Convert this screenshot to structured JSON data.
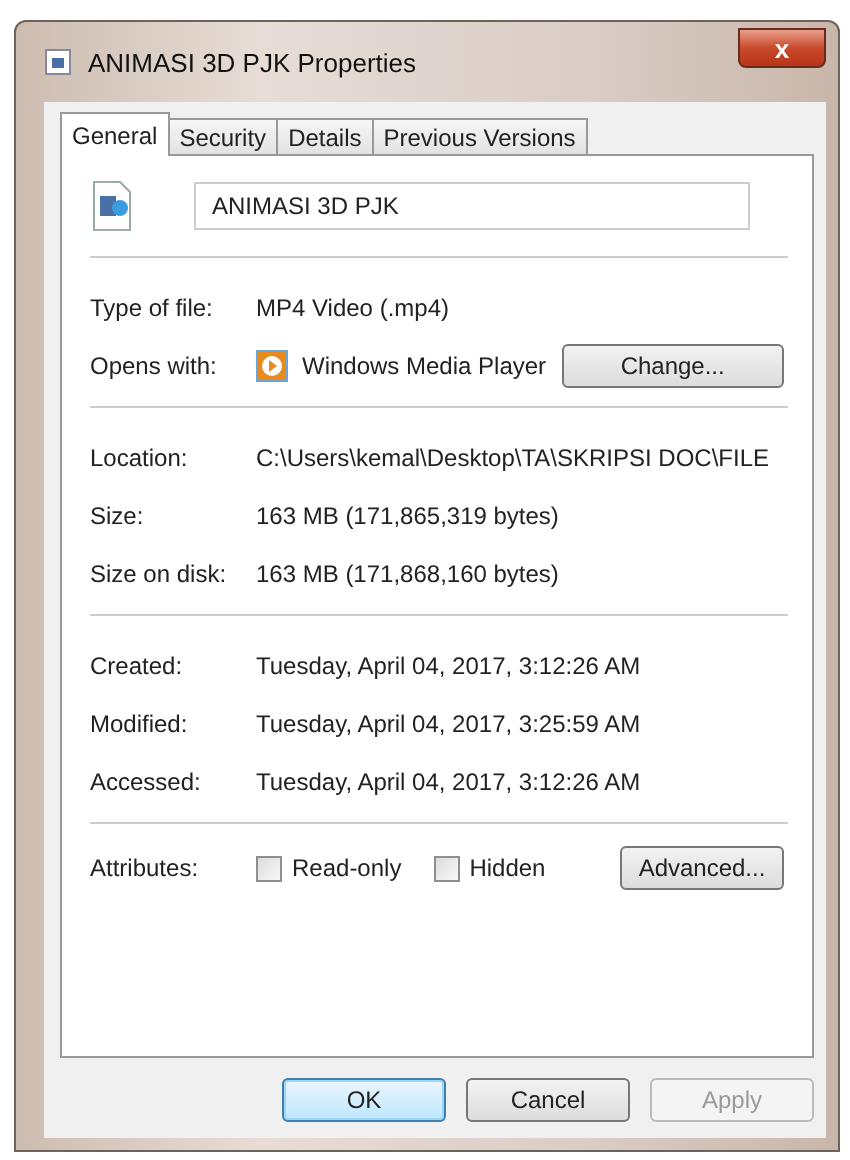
{
  "window": {
    "title": "ANIMASI 3D PJK  Properties",
    "close": "x"
  },
  "tabs": [
    {
      "label": "General",
      "selected": true
    },
    {
      "label": "Security",
      "selected": false
    },
    {
      "label": "Details",
      "selected": false
    },
    {
      "label": "Previous Versions",
      "selected": false
    }
  ],
  "file_name": {
    "value": "ANIMASI 3D PJK"
  },
  "sections": [
    [
      {
        "kind": "text",
        "label": "Type of file:",
        "value": "MP4 Video (.mp4)"
      },
      {
        "kind": "app",
        "label": "Opens with:",
        "value": "Windows Media Player",
        "button": "Change..."
      }
    ],
    [
      {
        "kind": "text",
        "label": "Location:",
        "value": "C:\\Users\\kemal\\Desktop\\TA\\SKRIPSI DOC\\FILE"
      },
      {
        "kind": "text",
        "label": "Size:",
        "value": "163 MB (171,865,319 bytes)"
      },
      {
        "kind": "text",
        "label": "Size on disk:",
        "value": "163 MB (171,868,160 bytes)"
      }
    ],
    [
      {
        "kind": "text",
        "label": "Created:",
        "value": "Tuesday, April 04, 2017, 3:12:26 AM"
      },
      {
        "kind": "text",
        "label": "Modified:",
        "value": "Tuesday, April 04, 2017, 3:25:59 AM"
      },
      {
        "kind": "text",
        "label": "Accessed:",
        "value": "Tuesday, April 04, 2017, 3:12:26 AM"
      }
    ]
  ],
  "attributes": {
    "label": "Attributes:",
    "options": [
      {
        "label": "Read-only",
        "checked": false
      },
      {
        "label": "Hidden",
        "checked": false
      }
    ],
    "button": "Advanced..."
  },
  "buttons": [
    {
      "label": "OK",
      "default": true,
      "disabled": false
    },
    {
      "label": "Cancel",
      "default": false,
      "disabled": false
    },
    {
      "label": "Apply",
      "default": false,
      "disabled": true
    }
  ]
}
